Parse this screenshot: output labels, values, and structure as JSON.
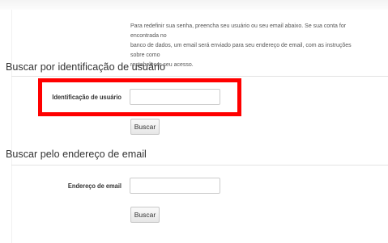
{
  "intro": {
    "line1": "Para redefinir sua senha, preencha seu usuário ou seu email abaixo. Se sua conta for encontrada no",
    "line2": "banco de dados, um email será enviado para seu endereço de email, com as instruções sobre como",
    "line3": "restabelecer seu acesso."
  },
  "username_section": {
    "title": "Buscar por identificação de usuário",
    "field_label": "Identificação de usuário",
    "field_value": "",
    "button_label": "Buscar"
  },
  "email_section": {
    "title": "Buscar pelo endereço de email",
    "field_label": "Endereço de email",
    "field_value": "",
    "button_label": "Buscar"
  },
  "highlight": {
    "color": "#ff0000",
    "target": "username_section"
  }
}
